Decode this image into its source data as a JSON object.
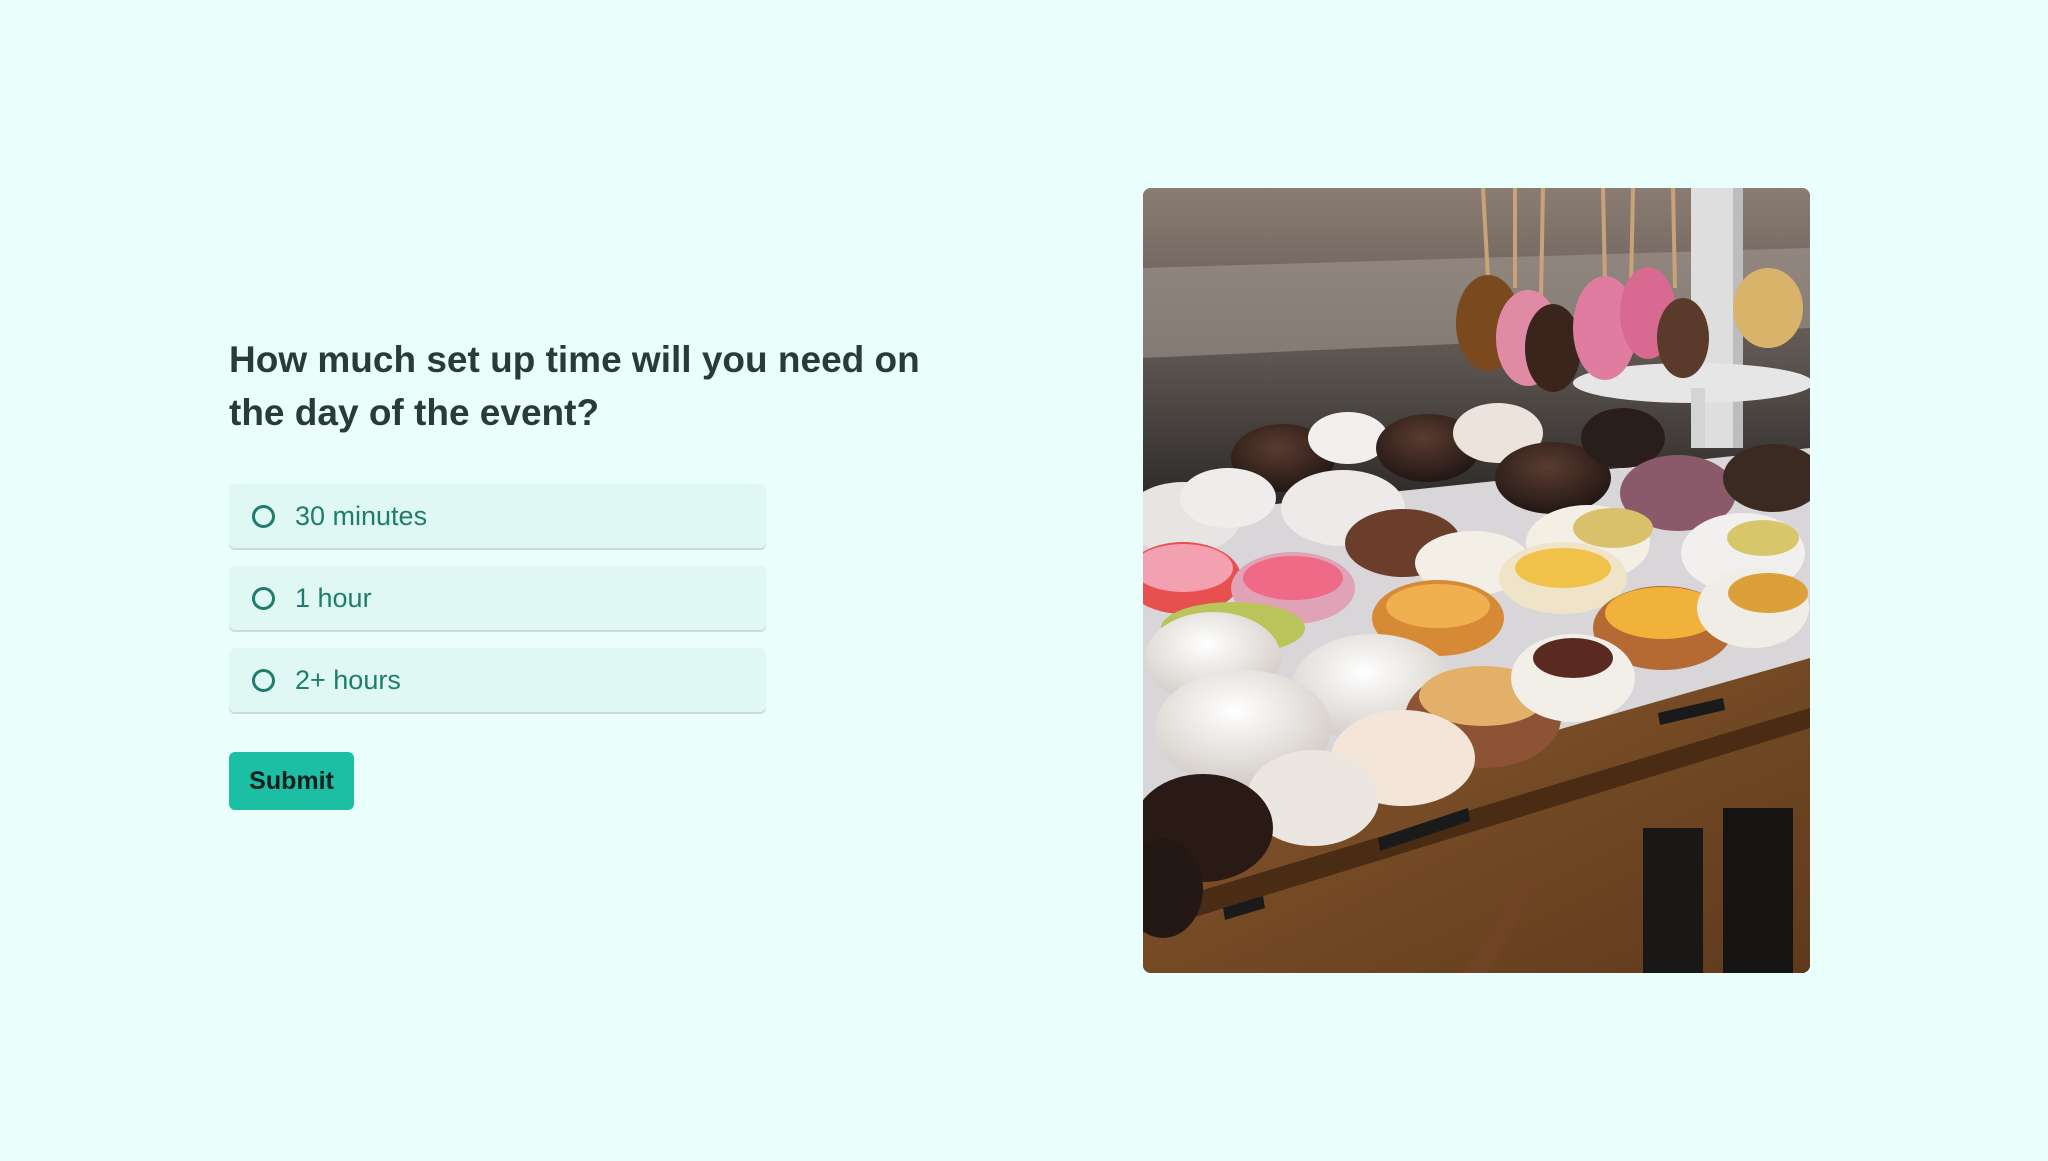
{
  "question": {
    "title": "How much set up time will you need on the day of the event?"
  },
  "options": [
    {
      "label": "30 minutes",
      "selected": false
    },
    {
      "label": "1 hour",
      "selected": false
    },
    {
      "label": "2+ hours",
      "selected": false
    }
  ],
  "submit": {
    "label": "Submit"
  },
  "photo": {
    "subject": "donuts-display-photo"
  },
  "colors": {
    "background": "#eafffb",
    "accent": "#1dbfa4",
    "option_bg": "#e0f8f3",
    "option_text": "#1f7d6b",
    "question_text": "#2a3a3a"
  }
}
